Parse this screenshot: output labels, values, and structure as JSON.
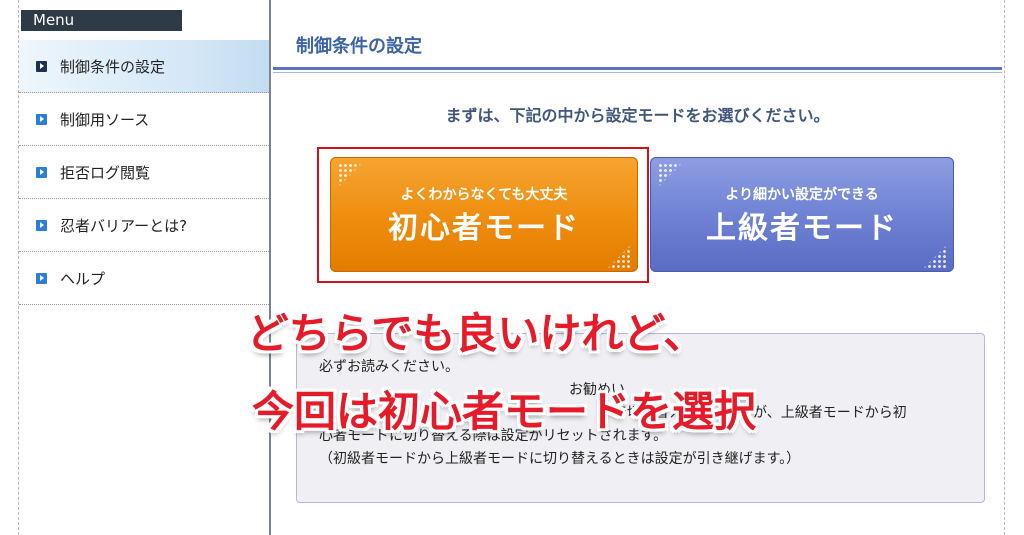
{
  "sidebar": {
    "header": "Menu",
    "items": [
      {
        "label": "制御条件の設定",
        "active": true
      },
      {
        "label": "制御用ソース",
        "active": false
      },
      {
        "label": "拒否ログ閲覧",
        "active": false
      },
      {
        "label": "忍者バリアーとは?",
        "active": false
      },
      {
        "label": "ヘルプ",
        "active": false
      }
    ]
  },
  "main": {
    "title": "制御条件の設定",
    "lead": "まずは、下記の中から設定モードをお選びください。",
    "beginner_mode": {
      "subtitle": "よくわからなくても大丈夫",
      "label": "初心者モード"
    },
    "advanced_mode": {
      "subtitle": "より細かい設定ができる",
      "label": "上級者モード"
    },
    "notice": {
      "lines": [
        "必ずお読みください。",
        "お勧めい",
        "中で切り替え　　　　　が、上級者モードから初",
        "心者モードに切り替える際は設定がリセットされます。",
        "（初級者モードから上級者モードに切り替えるときは設定が引き継げます。）"
      ]
    }
  },
  "overlay": {
    "line1": "どちらでも良いけれど、",
    "line2": "今回は初心者モードを選択"
  },
  "colors": {
    "highlight": "#d2121a",
    "beginner": "#ee8c0e",
    "advanced": "#6f82d4",
    "overlay_text": "#e61a28",
    "title": "#3d64a6"
  },
  "icons": {
    "menu_bullet": "play-arrow-icon",
    "button_decoration": "dot-pattern-icon"
  }
}
